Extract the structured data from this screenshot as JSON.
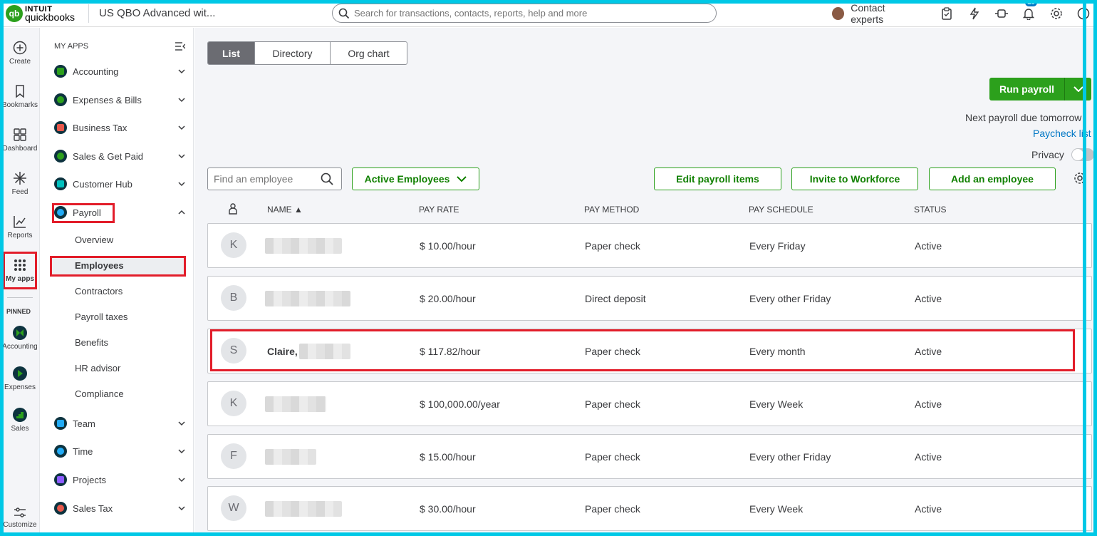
{
  "topbar": {
    "logo_intuit": "INTUIT",
    "logo_qb": "quickbooks",
    "logo_mark": "qb",
    "company": "US QBO Advanced wit...",
    "search_placeholder": "Search for transactions, contacts, reports, help and more",
    "contact": "Contact experts",
    "notifications_count": "19"
  },
  "rail": {
    "items": [
      {
        "label": "Create",
        "icon": "plus-circle-icon"
      },
      {
        "label": "Bookmarks",
        "icon": "bookmark-icon"
      },
      {
        "label": "Dashboard",
        "icon": "dashboard-icon"
      },
      {
        "label": "Feed",
        "icon": "sparkle-icon"
      },
      {
        "label": "Reports",
        "icon": "chart-line-icon"
      },
      {
        "label": "My apps",
        "icon": "grid-dots-icon"
      }
    ],
    "pinned_heading": "PINNED",
    "pinned": [
      {
        "label": "Accounting"
      },
      {
        "label": "Expenses"
      },
      {
        "label": "Sales"
      }
    ],
    "customize": "Customize"
  },
  "apps": {
    "heading": "MY APPS",
    "items": [
      {
        "label": "Accounting",
        "color": "#2ca01c"
      },
      {
        "label": "Expenses & Bills",
        "color": "#2ca01c"
      },
      {
        "label": "Business Tax",
        "color": "#e8594c"
      },
      {
        "label": "Sales & Get Paid",
        "color": "#2ca01c"
      },
      {
        "label": "Customer Hub",
        "color": "#00c1bf"
      },
      {
        "label": "Payroll",
        "color": "#21abf6"
      },
      {
        "label": "Team",
        "color": "#21abf6"
      },
      {
        "label": "Time",
        "color": "#21abf6"
      },
      {
        "label": "Projects",
        "color": "#8d5cff"
      },
      {
        "label": "Sales Tax",
        "color": "#e8594c"
      }
    ],
    "payroll_sub": [
      "Overview",
      "Employees",
      "Contractors",
      "Payroll taxes",
      "Benefits",
      "HR advisor",
      "Compliance"
    ]
  },
  "main": {
    "tabs": [
      "List",
      "Directory",
      "Org chart"
    ],
    "run_payroll": "Run payroll",
    "next_payroll": "Next payroll due tomorrow",
    "paycheck_list": "Paycheck list",
    "privacy": "Privacy",
    "find_placeholder": "Find an employee",
    "filter": "Active Employees",
    "buttons": [
      "Edit payroll items",
      "Invite to Workforce",
      "Add an employee"
    ],
    "columns": [
      "NAME ▲",
      "PAY RATE",
      "PAY METHOD",
      "PAY SCHEDULE",
      "STATUS"
    ],
    "employees": [
      {
        "initial": "K",
        "name": "",
        "rate": "$ 10.00/hour",
        "method": "Paper check",
        "schedule": "Every Friday",
        "status": "Active"
      },
      {
        "initial": "B",
        "name": "",
        "rate": "$ 20.00/hour",
        "method": "Direct deposit",
        "schedule": "Every other Friday",
        "status": "Active"
      },
      {
        "initial": "S",
        "name": "Claire,",
        "rate": "$ 117.82/hour",
        "method": "Paper check",
        "schedule": "Every month",
        "status": "Active"
      },
      {
        "initial": "K",
        "name": "",
        "rate": "$ 100,000.00/year",
        "method": "Paper check",
        "schedule": "Every Week",
        "status": "Active"
      },
      {
        "initial": "F",
        "name": "",
        "rate": "$ 15.00/hour",
        "method": "Paper check",
        "schedule": "Every other Friday",
        "status": "Active"
      },
      {
        "initial": "W",
        "name": "",
        "rate": "$ 30.00/hour",
        "method": "Paper check",
        "schedule": "Every Week",
        "status": "Active"
      }
    ]
  }
}
